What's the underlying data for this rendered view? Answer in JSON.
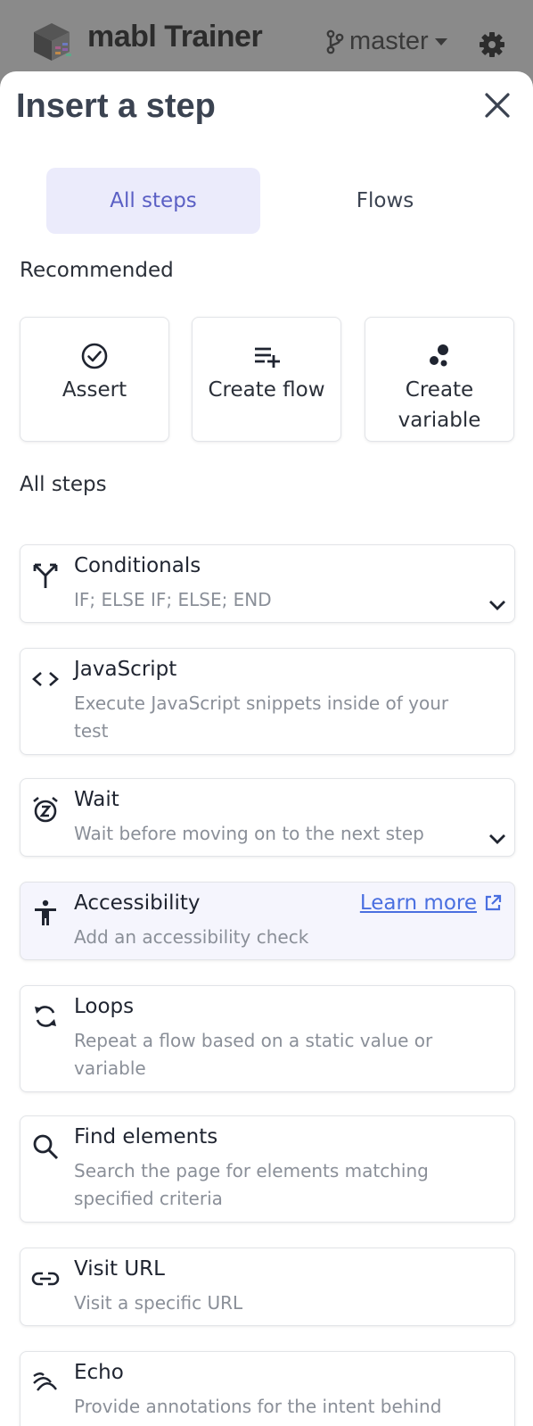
{
  "header": {
    "app_title": "mabl Trainer",
    "branch": "master",
    "logo_icon": "mabl-logo",
    "branch_icon": "git-branch-icon",
    "settings_icon": "gear-icon"
  },
  "drawer": {
    "title": "Insert a step",
    "close_icon": "close-icon",
    "tabs": [
      {
        "label": "All steps",
        "active": true
      },
      {
        "label": "Flows",
        "active": false
      }
    ],
    "recommended_label": "Recommended",
    "recommended": [
      {
        "label": "Assert",
        "icon": "check-circle-icon"
      },
      {
        "label": "Create flow",
        "icon": "playlist-add-icon"
      },
      {
        "label": "Create variable",
        "icon": "variable-icon"
      }
    ],
    "all_steps_label": "All steps",
    "steps": [
      {
        "title": "Conditionals",
        "description": "IF; ELSE IF; ELSE; END",
        "icon": "fork-icon",
        "expandable": true
      },
      {
        "title": "JavaScript",
        "description": "Execute JavaScript snippets inside of your test",
        "icon": "code-icon",
        "expandable": false
      },
      {
        "title": "Wait",
        "description": "Wait before moving on to the next step",
        "icon": "snooze-icon",
        "expandable": true
      },
      {
        "title": "Accessibility",
        "description": "Add an accessibility check",
        "icon": "accessibility-icon",
        "link": "Learn more",
        "link_icon": "external-link-icon"
      },
      {
        "title": "Loops",
        "description": "Repeat a flow based on a static value or variable",
        "icon": "loop-icon",
        "expandable": false
      },
      {
        "title": "Find elements",
        "description": "Search the page for elements matching specified criteria",
        "icon": "search-icon",
        "expandable": false
      },
      {
        "title": "Visit URL",
        "description": "Visit a specific URL",
        "icon": "link-icon",
        "expandable": false
      },
      {
        "title": "Echo",
        "description": "Provide annotations for the intent behind",
        "icon": "echo-icon",
        "expandable": false
      }
    ]
  },
  "colors": {
    "accent": "#5a5fc4",
    "tab_active_bg": "#ebebfb",
    "link": "#4a6fe0",
    "overlay": "#8a8a8a"
  }
}
